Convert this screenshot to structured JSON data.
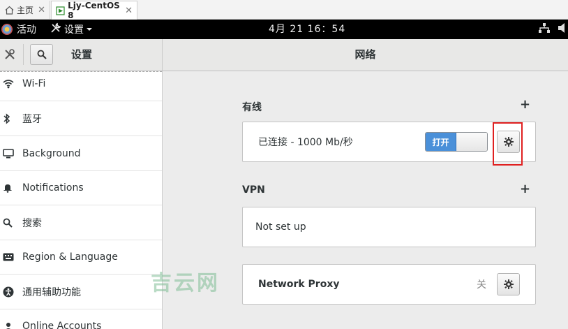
{
  "tabs": [
    {
      "label": "主页"
    },
    {
      "label": "Ljy-CentOS 8"
    }
  ],
  "topbar": {
    "activities": "活动",
    "app_menu": "设置",
    "clock": "4月 21  16：54"
  },
  "header": {
    "left_title": "设置",
    "main_title": "网络"
  },
  "sidebar": {
    "items": [
      {
        "label": "Wi-Fi",
        "icon": "wifi-icon"
      },
      {
        "label": "蓝牙",
        "icon": "bluetooth-icon"
      },
      {
        "label": "Background",
        "icon": "display-icon"
      },
      {
        "label": "Notifications",
        "icon": "bell-icon"
      },
      {
        "label": "搜索",
        "icon": "search-icon"
      },
      {
        "label": "Region & Language",
        "icon": "keyboard-icon"
      },
      {
        "label": "通用辅助功能",
        "icon": "accessibility-icon"
      },
      {
        "label": "Online Accounts",
        "icon": "accounts-icon"
      }
    ]
  },
  "main": {
    "wired": {
      "title": "有线",
      "add": "+",
      "status": "已连接 - 1000 Mb/秒",
      "switch_label": "打开",
      "switch_on": true
    },
    "vpn": {
      "title": "VPN",
      "add": "+",
      "status": "Not set up"
    },
    "proxy": {
      "label": "Network Proxy",
      "state": "关"
    }
  },
  "watermark": "吉云网",
  "colors": {
    "switch_on": "#4a90d9",
    "highlight": "#e02020",
    "topbar": "#000000"
  }
}
